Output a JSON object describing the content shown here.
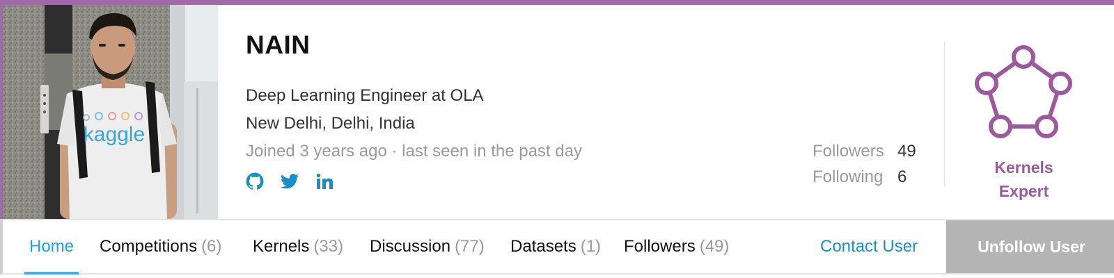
{
  "colors": {
    "accent": "#a06aa8",
    "tier_purple": "#9c5a9c",
    "link_blue": "#1a8fc4",
    "tab_active": "#1fa3dc",
    "muted_text": "#9a9a9a",
    "button_gray": "#b4b4b4"
  },
  "profile": {
    "name": "NAIN",
    "occupation": "Deep Learning Engineer at OLA",
    "location": "New Delhi, Delhi, India",
    "activity": "Joined 3 years ago · last seen in the past day",
    "photo_shirt_text": "kaggle",
    "socials": [
      {
        "icon": "github-icon"
      },
      {
        "icon": "twitter-icon"
      },
      {
        "icon": "linkedin-icon"
      }
    ]
  },
  "stats": {
    "followers_label": "Followers",
    "followers_value": "49",
    "following_label": "Following",
    "following_value": "6"
  },
  "tier": {
    "icon": "kernels-expert-pentagon-icon",
    "line1": "Kernels",
    "line2": "Expert"
  },
  "tabs": [
    {
      "label": "Home",
      "count": "",
      "active": true
    },
    {
      "label": "Competitions",
      "count": "(6)",
      "active": false
    },
    {
      "label": "Kernels",
      "count": "(33)",
      "active": false
    },
    {
      "label": "Discussion",
      "count": "(77)",
      "active": false
    },
    {
      "label": "Datasets",
      "count": "(1)",
      "active": false
    },
    {
      "label": "Followers",
      "count": "(49)",
      "active": false
    }
  ],
  "actions": {
    "contact_label": "Contact User",
    "unfollow_label": "Unfollow User"
  }
}
